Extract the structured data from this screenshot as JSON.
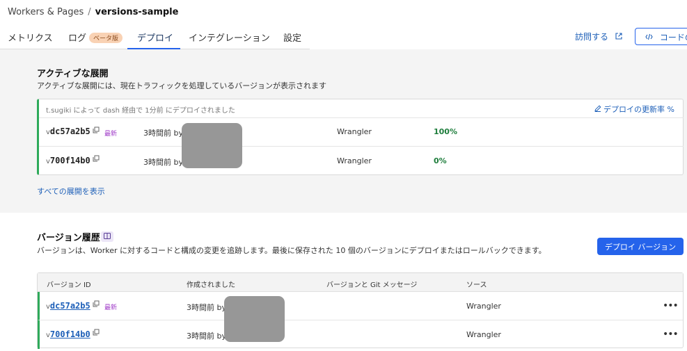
{
  "breadcrumb": {
    "root": "Workers & Pages",
    "separator": "/",
    "current": "versions-sample"
  },
  "tabs": [
    {
      "label": "メトリクス"
    },
    {
      "label": "ログ",
      "badge": "ベータ版"
    },
    {
      "label": "デプロイ",
      "active": true
    },
    {
      "label": "インテグレーション"
    },
    {
      "label": "設定"
    }
  ],
  "header_actions": {
    "visit_label": "訪問する",
    "code_label": "コードの"
  },
  "active_deployments": {
    "title": "アクティブな展開",
    "description": "アクティブな展開には、現在トラフィックを処理しているバージョンが表示されます",
    "card_header": "t.sugiki によって dash 経由で 1分前 にデプロイされました",
    "rate_link": "デプロイの更新率 %",
    "rows": [
      {
        "version_prefix": "v",
        "version_id": "dc57a2b5",
        "latest": "最新",
        "created": "3時間前 by",
        "source": "Wrangler",
        "percent": "100%"
      },
      {
        "version_prefix": "v",
        "version_id": "700f14b0",
        "latest": "",
        "created": "3時間前 by",
        "source": "Wrangler",
        "percent": "0%"
      }
    ],
    "show_all": "すべての展開を表示"
  },
  "version_history": {
    "title": "バージョン履歴",
    "description": "バージョンは、Worker に対するコードと構成の変更を追跡します。最後に保存された 10 個のバージョンにデプロイまたはロールバックできます。",
    "deploy_button": "デプロイ バージョン",
    "columns": [
      "バージョン ID",
      "作成されました",
      "バージョンと Git メッセージ",
      "ソース"
    ],
    "rows": [
      {
        "version_prefix": "v",
        "version_id": "dc57a2b5",
        "latest": "最新",
        "created": "3時間前 by",
        "message": "",
        "source": "Wrangler"
      },
      {
        "version_prefix": "v",
        "version_id": "700f14b0",
        "latest": "",
        "created": "3時間前 by",
        "message": "",
        "source": "Wrangler"
      }
    ]
  },
  "colors": {
    "accent": "#2563eb",
    "link": "#1d5fb8",
    "active_bar": "#2eaa5a",
    "percent": "#1e7d3c",
    "latest_badge": "#a03cc8"
  },
  "icons": [
    "copy-icon",
    "external-link-icon",
    "code-icon",
    "edit-pencil-icon",
    "version-history-icon",
    "more-horizontal-icon"
  ]
}
